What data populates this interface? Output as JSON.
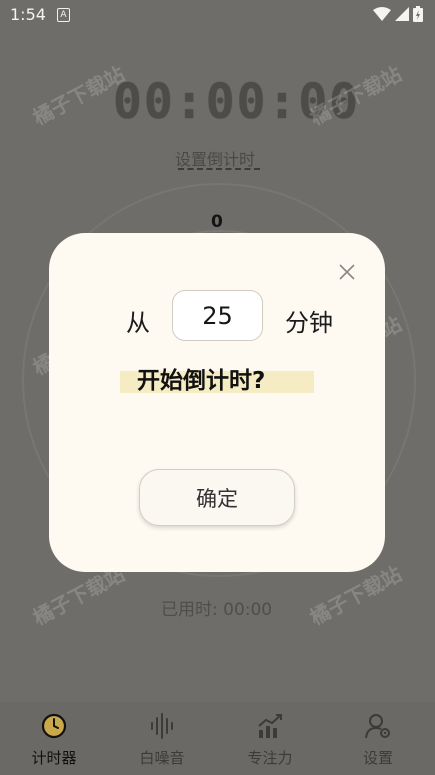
{
  "status_bar": {
    "time": "1:54",
    "badge": "A"
  },
  "timer": {
    "display": "00:00:00",
    "set_countdown_link": "设置倒计时",
    "ring_count": "0",
    "elapsed_text": "已用时: 00:00"
  },
  "watermark_text": "橘子下载站",
  "dialog": {
    "from_label": "从",
    "minutes_value": "25",
    "minutes_unit": "分钟",
    "question": "开始倒计时?",
    "confirm_label": "确定",
    "highlight_color": "#f6ecc3"
  },
  "nav": {
    "items": [
      {
        "label": "计时器",
        "icon": "clock-icon",
        "active": true
      },
      {
        "label": "白噪音",
        "icon": "sound-wave-icon",
        "active": false
      },
      {
        "label": "专注力",
        "icon": "trend-chart-icon",
        "active": false
      },
      {
        "label": "设置",
        "icon": "user-gear-icon",
        "active": false
      }
    ]
  }
}
